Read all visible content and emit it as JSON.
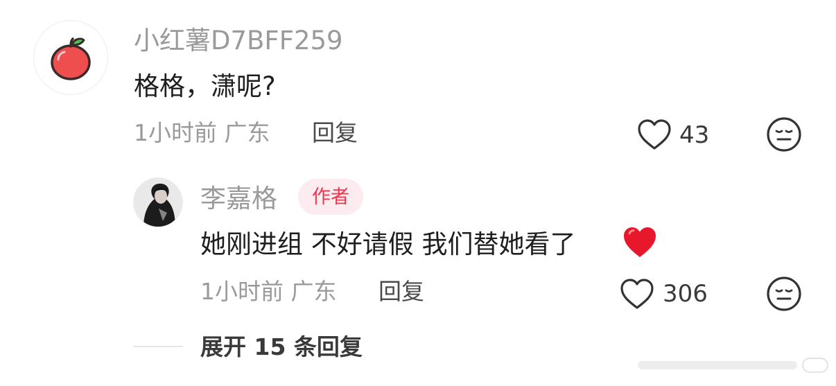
{
  "comment": {
    "username": "小红薯D7BFF259",
    "text": "格格，潇呢?",
    "time_location": "1小时前 广东",
    "reply_label": "回复",
    "likes": "43",
    "avatar_icon": "apple-icon"
  },
  "reply": {
    "username": "李嘉格",
    "badge": "作者",
    "text": "她刚进组 不好请假 我们替她看了",
    "emoji": "red-heart-icon",
    "time_location": "1小时前 广东",
    "reply_label": "回复",
    "likes": "306"
  },
  "expand_label": "展开 15 条回复",
  "colors": {
    "badge_bg": "#fdecef",
    "badge_text": "#f0364f",
    "heart_emoji": "#e8182c",
    "muted_text": "#9a9a9a"
  }
}
